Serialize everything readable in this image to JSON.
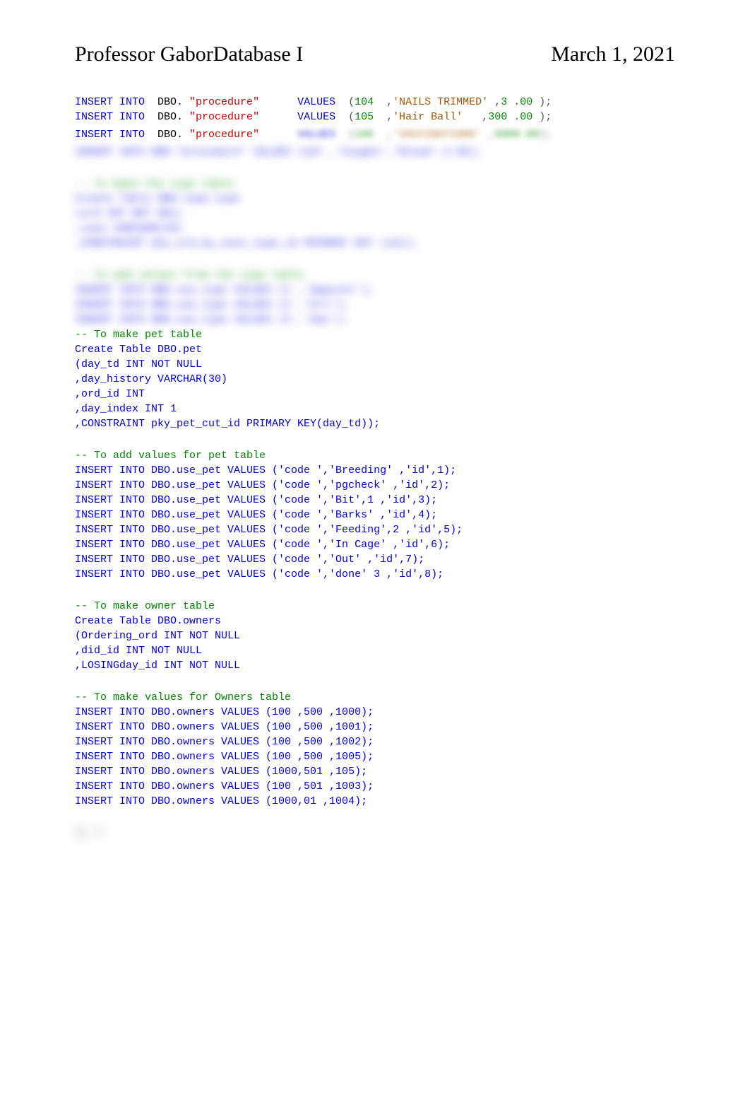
{
  "header": {
    "left": "Professor GaborDatabase I",
    "right": "March 1, 2021"
  },
  "code": {
    "lines": [
      {
        "insert": "INSERT INTO",
        "dbo": "  DBO.",
        "proc": " \"procedure\"",
        "values": "      VALUES",
        "paren1": "  (",
        "num": "104",
        "comma1": "  ,",
        "str": "'NAILS TRIMMED'",
        "comma2": " ,",
        "dec1": "3",
        "dot": " .",
        "dec2": "00",
        "paren2": " );"
      },
      {
        "insert": "INSERT INTO",
        "dbo": "  DBO.",
        "proc": " \"procedure\"",
        "values": "      VALUES",
        "paren1": "  (",
        "num": "105",
        "comma1": "  ,",
        "str": "'Hair Ball'",
        "comma2": "   ,",
        "dec1": "300",
        "dot": " .",
        "dec2": "00",
        "paren2": " );"
      },
      {
        "insert": "INSERT INTO",
        "dbo": "  DBO.",
        "proc": " \"procedure\"",
        "values": "      VALUES",
        "paren1": "  (",
        "num": "106",
        "comma1": "  ,",
        "str": "'VACCINATIONS'",
        "comma2": " ,",
        "dec1": "5000",
        "dot": ".00",
        "dec2": "",
        "paren2": ");"
      }
    ]
  },
  "blurred": {
    "s1_l1": "INSERT INTO DBO.\"procedure\" VALUES (107 ,'Coughs','Blood',4.95);",
    "s2_comment": "-- To make the type table",
    "s2_l1": "Create Table DBO.type_type",
    "s2_l2": "(ord INT NOT NULL",
    "s2_l3": ",uses VARCHAR(20)",
    "s2_l4": ",CONSTRAINT pky_ord_by_uses_type_id PRIMARY KEY (id));",
    "s3_comment": "-- To add values from the type table",
    "s3_l1": "INSERT INTO DBO.use_type VALUES (1 ,'Appoint');",
    "s3_l2": "INSERT INTO DBO.use_type VALUES (2 ,'hrs');",
    "s3_l3": "INSERT INTO DBO.use_type VALUES (3 ,'day');",
    "s4_comment": "-- To make pet table",
    "s4_l1": "Create Table DBO.pet",
    "s4_l2": "(day_td INT NOT NULL",
    "s4_l3": ",day_history VARCHAR(30)",
    "s4_l4": ",ord_id INT",
    "s4_l5": ",day_index INT 1",
    "s4_l6": ",CONSTRAINT pky_pet_cut_id PRIMARY KEY(day_td));",
    "s5_comment": "-- To add values for pet table",
    "s5_l1": "INSERT INTO DBO.use_pet VALUES ('code ','Breeding' ,'id',1);",
    "s5_l2": "INSERT INTO DBO.use_pet VALUES ('code ','pgcheck' ,'id',2);",
    "s5_l3": "INSERT INTO DBO.use_pet VALUES ('code ','Bit',1 ,'id',3);",
    "s5_l4": "INSERT INTO DBO.use_pet VALUES ('code ','Barks' ,'id',4);",
    "s5_l5": "INSERT INTO DBO.use_pet VALUES ('code ','Feeding',2 ,'id',5);",
    "s5_l6": "INSERT INTO DBO.use_pet VALUES ('code ','In Cage' ,'id',6);",
    "s5_l7": "INSERT INTO DBO.use_pet VALUES ('code ','Out' ,'id',7);",
    "s5_l8": "INSERT INTO DBO.use_pet VALUES ('code ','done' 3 ,'id',8);",
    "s6_comment": "-- To make owner table",
    "s6_l1": "Create Table DBO.owners",
    "s6_l2": "(Ordering_ord INT NOT NULL",
    "s6_l3": ",did_id INT NOT NULL",
    "s6_l4": ",LOSINGday_id INT NOT NULL",
    "s7_comment": "-- To make values for Owners table",
    "s7_l1": "INSERT INTO DBO.owners VALUES (100 ,500 ,1000);",
    "s7_l2": "INSERT INTO DBO.owners VALUES (100 ,500 ,1001);",
    "s7_l3": "INSERT INTO DBO.owners VALUES (100 ,500 ,1002);",
    "s7_l4": "INSERT INTO DBO.owners VALUES (100 ,500 ,1005);",
    "s7_l5": "INSERT INTO DBO.owners VALUES (1000,501 ,105);",
    "s7_l6": "INSERT INTO DBO.owners VALUES (100 ,501 ,1003);",
    "s7_l7": "INSERT INTO DBO.owners VALUES (1000,01 ,1004);",
    "footer": "ㅁ 7"
  }
}
